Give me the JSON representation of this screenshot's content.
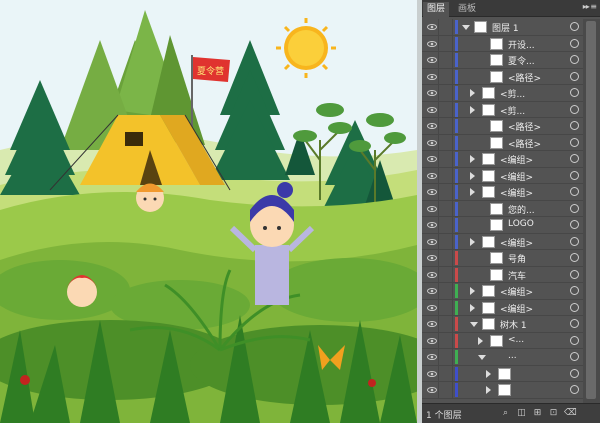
{
  "panel": {
    "tabs": [
      {
        "label": "图层"
      },
      {
        "label": "画板"
      }
    ],
    "menu_glyph": "▸▸ ≡",
    "footer_label": "1 个图层",
    "rows": [
      {
        "label": "图层 1",
        "indent": 0,
        "expand": "down",
        "bar": "#4a63c9",
        "thumb": true
      },
      {
        "label": "开设...",
        "indent": 2,
        "expand": "",
        "bar": "#4a63c9",
        "thumb": true
      },
      {
        "label": "夏令...",
        "indent": 2,
        "expand": "",
        "bar": "#4a63c9",
        "thumb": true
      },
      {
        "label": "<路径>",
        "indent": 2,
        "expand": "",
        "bar": "#4a63c9",
        "thumb": true
      },
      {
        "label": "<剪...",
        "indent": 1,
        "expand": "right",
        "bar": "#4a63c9",
        "thumb": true
      },
      {
        "label": "<剪...",
        "indent": 1,
        "expand": "right",
        "bar": "#4a63c9",
        "thumb": true
      },
      {
        "label": "<路径>",
        "indent": 2,
        "expand": "",
        "bar": "#4a63c9",
        "thumb": true
      },
      {
        "label": "<路径>",
        "indent": 2,
        "expand": "",
        "bar": "#4a63c9",
        "thumb": true
      },
      {
        "label": "<编组>",
        "indent": 1,
        "expand": "right",
        "bar": "#4a63c9",
        "thumb": true
      },
      {
        "label": "<编组>",
        "indent": 1,
        "expand": "right",
        "bar": "#4a63c9",
        "thumb": true
      },
      {
        "label": "<编组>",
        "indent": 1,
        "expand": "right",
        "bar": "#4a63c9",
        "thumb": true
      },
      {
        "label": "您的...",
        "indent": 2,
        "expand": "",
        "bar": "#4a63c9",
        "thumb": true
      },
      {
        "label": "LOGO",
        "indent": 2,
        "expand": "",
        "bar": "#4a63c9",
        "thumb": true
      },
      {
        "label": "<编组>",
        "indent": 1,
        "expand": "right",
        "bar": "#4a63c9",
        "thumb": true
      },
      {
        "label": "号角",
        "indent": 2,
        "expand": "",
        "bar": "#c94a4a",
        "thumb": true
      },
      {
        "label": "汽车",
        "indent": 2,
        "expand": "",
        "bar": "#c94a4a",
        "thumb": true
      },
      {
        "label": "<编组>",
        "indent": 1,
        "expand": "right",
        "bar": "#3fae52",
        "thumb": true
      },
      {
        "label": "<编组>",
        "indent": 1,
        "expand": "right",
        "bar": "#3fae52",
        "thumb": true
      },
      {
        "label": "树木 1",
        "indent": 1,
        "expand": "down",
        "bar": "#c94a4a",
        "thumb": true
      },
      {
        "label": "<...",
        "indent": 2,
        "expand": "right",
        "bar": "#c94a4a",
        "thumb": true
      },
      {
        "label": "...",
        "indent": 2,
        "expand": "down",
        "bar": "#3fae52",
        "thumb": false
      },
      {
        "label": "",
        "indent": 3,
        "expand": "right",
        "bar": "#3f4fc9",
        "thumb": true
      },
      {
        "label": "",
        "indent": 3,
        "expand": "right",
        "bar": "#3f4fc9",
        "thumb": true
      }
    ]
  },
  "artwork": {
    "flag_text": "夏令营",
    "sun_color": "#f8b51d",
    "sky_color": "#eaf5f8",
    "grass_color": "#9bc94a",
    "tent_color": "#f3c22a"
  }
}
